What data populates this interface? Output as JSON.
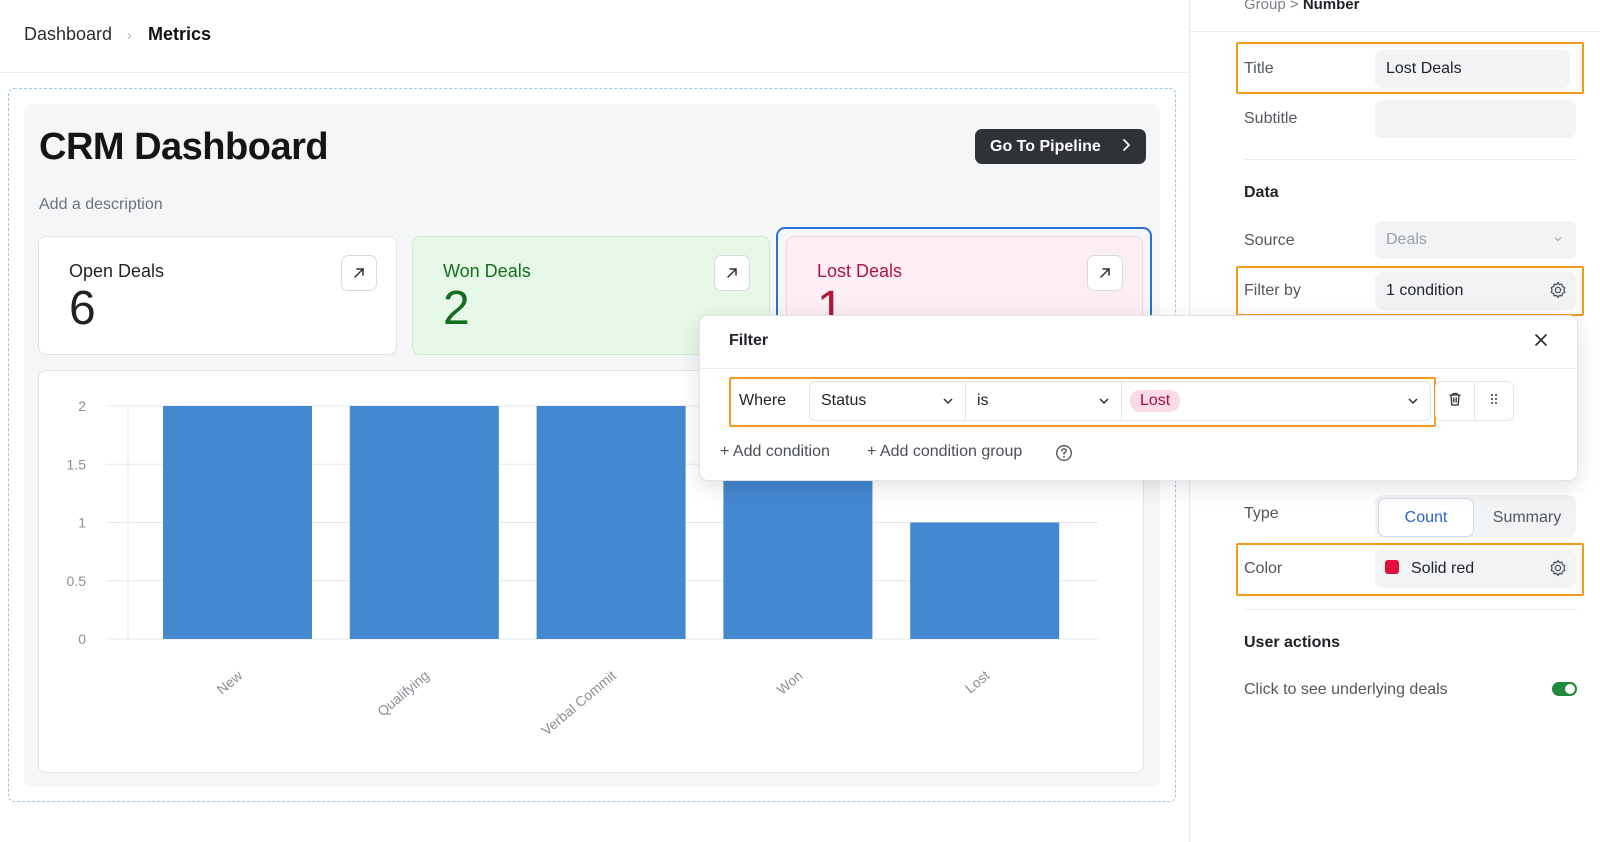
{
  "breadcrumb": {
    "root": "Dashboard",
    "separator": "›",
    "current": "Metrics"
  },
  "dashboard": {
    "title": "CRM Dashboard",
    "description": "Add a description",
    "pipeline_button": "Go To Pipeline",
    "cards": [
      {
        "label": "Open Deals",
        "value": "6"
      },
      {
        "label": "Won Deals",
        "value": "2"
      },
      {
        "label": "Lost Deals",
        "value": "1"
      }
    ]
  },
  "chart_data": {
    "type": "bar",
    "categories": [
      "New",
      "Qualifying",
      "Verbal Commit",
      "Won",
      "Lost"
    ],
    "values": [
      2,
      2,
      2,
      2,
      1
    ],
    "yticks": [
      "0",
      "0.5",
      "1",
      "1.5",
      "2"
    ],
    "ylim": [
      0,
      2
    ],
    "grid": true,
    "bar_color": "#4488d0"
  },
  "panel": {
    "breadcrumb_parent": "Group",
    "breadcrumb_sep": ">",
    "breadcrumb_current": "Number",
    "title_label": "Title",
    "title_value": "Lost Deals",
    "subtitle_label": "Subtitle",
    "subtitle_value": "",
    "data_heading": "Data",
    "source_label": "Source",
    "source_value": "Deals",
    "filter_label": "Filter by",
    "filter_value": "1 condition",
    "type_label": "Type",
    "type_options": [
      "Count",
      "Summary"
    ],
    "type_selected": "Count",
    "color_label": "Color",
    "color_value": "Solid red",
    "color_hex": "#e0103a",
    "user_actions_heading": "User actions",
    "click_through_label": "Click to see underlying deals",
    "click_through_enabled": true
  },
  "filter": {
    "title": "Filter",
    "where": "Where",
    "field": "Status",
    "operator": "is",
    "value": "Lost",
    "add_condition": "Add condition",
    "add_condition_group": "Add condition group"
  }
}
